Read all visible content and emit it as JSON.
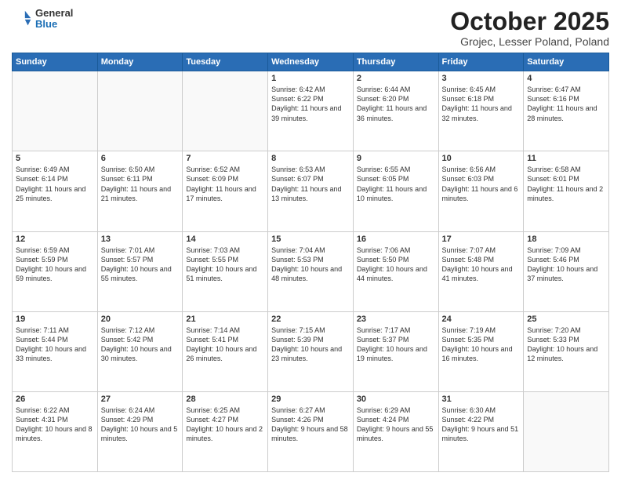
{
  "header": {
    "logo": {
      "general": "General",
      "blue": "Blue"
    },
    "title": "October 2025",
    "location": "Grojec, Lesser Poland, Poland"
  },
  "calendar": {
    "days_of_week": [
      "Sunday",
      "Monday",
      "Tuesday",
      "Wednesday",
      "Thursday",
      "Friday",
      "Saturday"
    ],
    "weeks": [
      [
        {
          "day": "",
          "info": ""
        },
        {
          "day": "",
          "info": ""
        },
        {
          "day": "",
          "info": ""
        },
        {
          "day": "1",
          "info": "Sunrise: 6:42 AM\nSunset: 6:22 PM\nDaylight: 11 hours\nand 39 minutes."
        },
        {
          "day": "2",
          "info": "Sunrise: 6:44 AM\nSunset: 6:20 PM\nDaylight: 11 hours\nand 36 minutes."
        },
        {
          "day": "3",
          "info": "Sunrise: 6:45 AM\nSunset: 6:18 PM\nDaylight: 11 hours\nand 32 minutes."
        },
        {
          "day": "4",
          "info": "Sunrise: 6:47 AM\nSunset: 6:16 PM\nDaylight: 11 hours\nand 28 minutes."
        }
      ],
      [
        {
          "day": "5",
          "info": "Sunrise: 6:49 AM\nSunset: 6:14 PM\nDaylight: 11 hours\nand 25 minutes."
        },
        {
          "day": "6",
          "info": "Sunrise: 6:50 AM\nSunset: 6:11 PM\nDaylight: 11 hours\nand 21 minutes."
        },
        {
          "day": "7",
          "info": "Sunrise: 6:52 AM\nSunset: 6:09 PM\nDaylight: 11 hours\nand 17 minutes."
        },
        {
          "day": "8",
          "info": "Sunrise: 6:53 AM\nSunset: 6:07 PM\nDaylight: 11 hours\nand 13 minutes."
        },
        {
          "day": "9",
          "info": "Sunrise: 6:55 AM\nSunset: 6:05 PM\nDaylight: 11 hours\nand 10 minutes."
        },
        {
          "day": "10",
          "info": "Sunrise: 6:56 AM\nSunset: 6:03 PM\nDaylight: 11 hours\nand 6 minutes."
        },
        {
          "day": "11",
          "info": "Sunrise: 6:58 AM\nSunset: 6:01 PM\nDaylight: 11 hours\nand 2 minutes."
        }
      ],
      [
        {
          "day": "12",
          "info": "Sunrise: 6:59 AM\nSunset: 5:59 PM\nDaylight: 10 hours\nand 59 minutes."
        },
        {
          "day": "13",
          "info": "Sunrise: 7:01 AM\nSunset: 5:57 PM\nDaylight: 10 hours\nand 55 minutes."
        },
        {
          "day": "14",
          "info": "Sunrise: 7:03 AM\nSunset: 5:55 PM\nDaylight: 10 hours\nand 51 minutes."
        },
        {
          "day": "15",
          "info": "Sunrise: 7:04 AM\nSunset: 5:53 PM\nDaylight: 10 hours\nand 48 minutes."
        },
        {
          "day": "16",
          "info": "Sunrise: 7:06 AM\nSunset: 5:50 PM\nDaylight: 10 hours\nand 44 minutes."
        },
        {
          "day": "17",
          "info": "Sunrise: 7:07 AM\nSunset: 5:48 PM\nDaylight: 10 hours\nand 41 minutes."
        },
        {
          "day": "18",
          "info": "Sunrise: 7:09 AM\nSunset: 5:46 PM\nDaylight: 10 hours\nand 37 minutes."
        }
      ],
      [
        {
          "day": "19",
          "info": "Sunrise: 7:11 AM\nSunset: 5:44 PM\nDaylight: 10 hours\nand 33 minutes."
        },
        {
          "day": "20",
          "info": "Sunrise: 7:12 AM\nSunset: 5:42 PM\nDaylight: 10 hours\nand 30 minutes."
        },
        {
          "day": "21",
          "info": "Sunrise: 7:14 AM\nSunset: 5:41 PM\nDaylight: 10 hours\nand 26 minutes."
        },
        {
          "day": "22",
          "info": "Sunrise: 7:15 AM\nSunset: 5:39 PM\nDaylight: 10 hours\nand 23 minutes."
        },
        {
          "day": "23",
          "info": "Sunrise: 7:17 AM\nSunset: 5:37 PM\nDaylight: 10 hours\nand 19 minutes."
        },
        {
          "day": "24",
          "info": "Sunrise: 7:19 AM\nSunset: 5:35 PM\nDaylight: 10 hours\nand 16 minutes."
        },
        {
          "day": "25",
          "info": "Sunrise: 7:20 AM\nSunset: 5:33 PM\nDaylight: 10 hours\nand 12 minutes."
        }
      ],
      [
        {
          "day": "26",
          "info": "Sunrise: 6:22 AM\nSunset: 4:31 PM\nDaylight: 10 hours\nand 8 minutes."
        },
        {
          "day": "27",
          "info": "Sunrise: 6:24 AM\nSunset: 4:29 PM\nDaylight: 10 hours\nand 5 minutes."
        },
        {
          "day": "28",
          "info": "Sunrise: 6:25 AM\nSunset: 4:27 PM\nDaylight: 10 hours\nand 2 minutes."
        },
        {
          "day": "29",
          "info": "Sunrise: 6:27 AM\nSunset: 4:26 PM\nDaylight: 9 hours\nand 58 minutes."
        },
        {
          "day": "30",
          "info": "Sunrise: 6:29 AM\nSunset: 4:24 PM\nDaylight: 9 hours\nand 55 minutes."
        },
        {
          "day": "31",
          "info": "Sunrise: 6:30 AM\nSunset: 4:22 PM\nDaylight: 9 hours\nand 51 minutes."
        },
        {
          "day": "",
          "info": ""
        }
      ]
    ]
  }
}
